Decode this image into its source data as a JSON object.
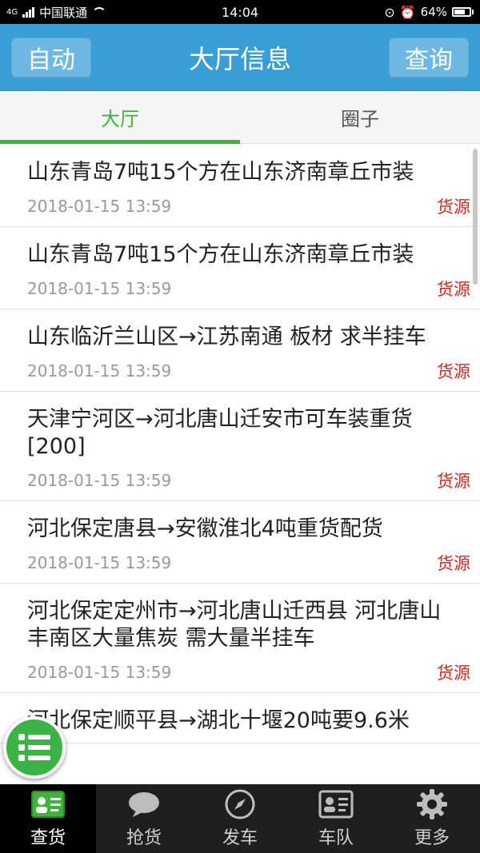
{
  "status_bar": {
    "carrier": "中国联通",
    "network": "4G",
    "time": "14:04",
    "battery": "64%",
    "battery_level": 0.64
  },
  "header": {
    "left_button": "自动",
    "title": "大厅信息",
    "right_button": "查询"
  },
  "tabs": [
    {
      "label": "大厅",
      "active": true
    },
    {
      "label": "圈子",
      "active": false
    }
  ],
  "items": [
    {
      "title": "山东青岛7吨15个方在山东济南章丘市装",
      "time": "2018-01-15 13:59",
      "tag": "货源"
    },
    {
      "title": "山东青岛7吨15个方在山东济南章丘市装",
      "time": "2018-01-15 13:59",
      "tag": "货源"
    },
    {
      "title": "山东临沂兰山区→江苏南通 板材 求半挂车",
      "time": "2018-01-15 13:59",
      "tag": "货源"
    },
    {
      "title": "天津宁河区→河北唐山迁安市可车装重货[200]",
      "time": "2018-01-15 13:59",
      "tag": "货源"
    },
    {
      "title": "河北保定唐县→安徽淮北4吨重货配货",
      "time": "2018-01-15 13:59",
      "tag": "货源"
    },
    {
      "title": "河北保定定州市→河北唐山迁西县 河北唐山丰南区大量焦炭 需大量半挂车",
      "time": "2018-01-15 13:59",
      "tag": "货源"
    },
    {
      "title": "河北保定顺平县→湖北十堰20吨要9.6米",
      "time": "",
      "tag": ""
    }
  ],
  "bottom_nav": [
    {
      "label": "查货",
      "icon": "id-card-icon",
      "active": true
    },
    {
      "label": "抢货",
      "icon": "chat-bubble-icon",
      "active": false
    },
    {
      "label": "发车",
      "icon": "compass-icon",
      "active": false
    },
    {
      "label": "车队",
      "icon": "contact-card-icon",
      "active": false
    },
    {
      "label": "更多",
      "icon": "gear-icon",
      "active": false
    }
  ],
  "colors": {
    "header": "#3a9ed6",
    "accent_green": "#3db33a",
    "tag_red": "#d9261c",
    "bottom_bar": "#1f1f1f"
  }
}
